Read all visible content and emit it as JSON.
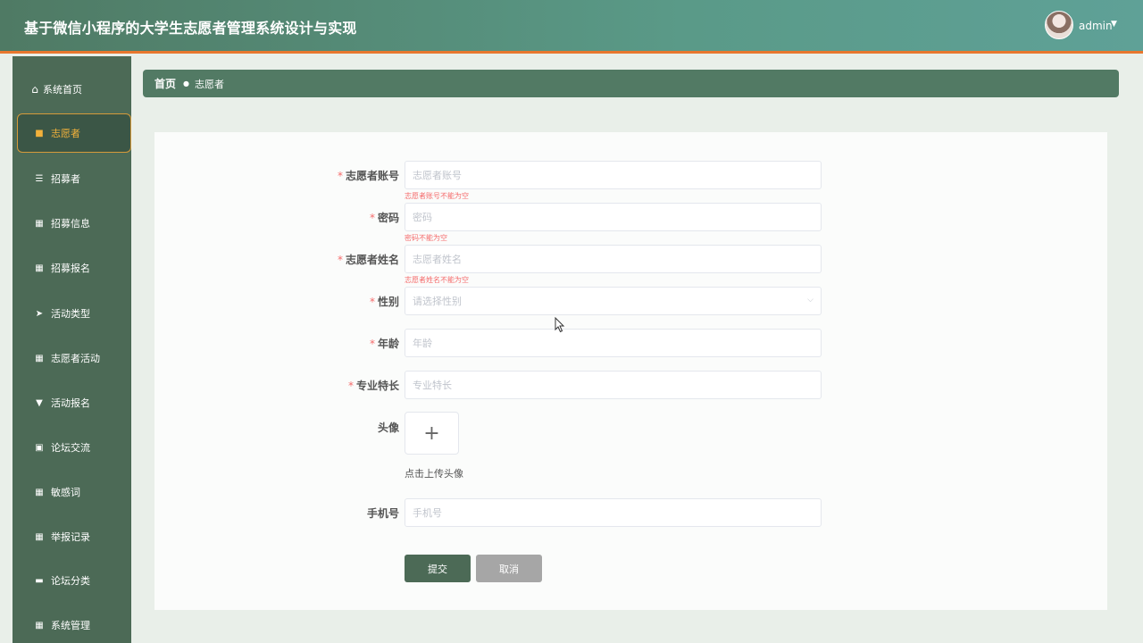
{
  "header": {
    "title": "基于微信小程序的大学生志愿者管理系统设计与实现",
    "user": "admin",
    "avatar_icon": "user-avatar"
  },
  "sidebar": {
    "items": [
      {
        "label": "系统首页",
        "icon": "home-icon"
      },
      {
        "label": "志愿者",
        "icon": "clipboard-icon",
        "active": true
      },
      {
        "label": "招募者",
        "icon": "sliders-icon"
      },
      {
        "label": "招募信息",
        "icon": "grid-icon"
      },
      {
        "label": "招募报名",
        "icon": "grid-icon"
      },
      {
        "label": "活动类型",
        "icon": "send-icon"
      },
      {
        "label": "志愿者活动",
        "icon": "grid-icon"
      },
      {
        "label": "活动报名",
        "icon": "pin-icon"
      },
      {
        "label": "论坛交流",
        "icon": "briefcase-icon"
      },
      {
        "label": "敏感词",
        "icon": "grid-icon"
      },
      {
        "label": "举报记录",
        "icon": "grid-icon"
      },
      {
        "label": "论坛分类",
        "icon": "message-icon"
      },
      {
        "label": "系统管理",
        "icon": "grid-icon"
      }
    ]
  },
  "breadcrumb": {
    "home": "首页",
    "current": "志愿者"
  },
  "form": {
    "account": {
      "label": "志愿者账号",
      "placeholder": "志愿者账号",
      "value": "",
      "error": "志愿者账号不能为空",
      "required": true
    },
    "password": {
      "label": "密码",
      "placeholder": "密码",
      "value": "",
      "error": "密码不能为空",
      "required": true
    },
    "name": {
      "label": "志愿者姓名",
      "placeholder": "志愿者姓名",
      "value": "",
      "error": "志愿者姓名不能为空",
      "required": true
    },
    "gender": {
      "label": "性别",
      "placeholder": "请选择性别",
      "required": true
    },
    "age": {
      "label": "年龄",
      "placeholder": "年龄",
      "value": "",
      "required": true
    },
    "specialty": {
      "label": "专业特长",
      "placeholder": "专业特长",
      "value": "",
      "required": true
    },
    "avatar": {
      "label": "头像",
      "hint": "点击上传头像",
      "icon": "plus-icon"
    },
    "phone": {
      "label": "手机号",
      "placeholder": "手机号",
      "value": ""
    },
    "required_mark": "*",
    "submit": "提交",
    "cancel": "取消"
  },
  "colors": {
    "header": "#4f7a64",
    "sidebar": "#4c6a56",
    "accent": "#f2b13b",
    "error": "#f56c6c",
    "header_border": "#e8772e"
  }
}
